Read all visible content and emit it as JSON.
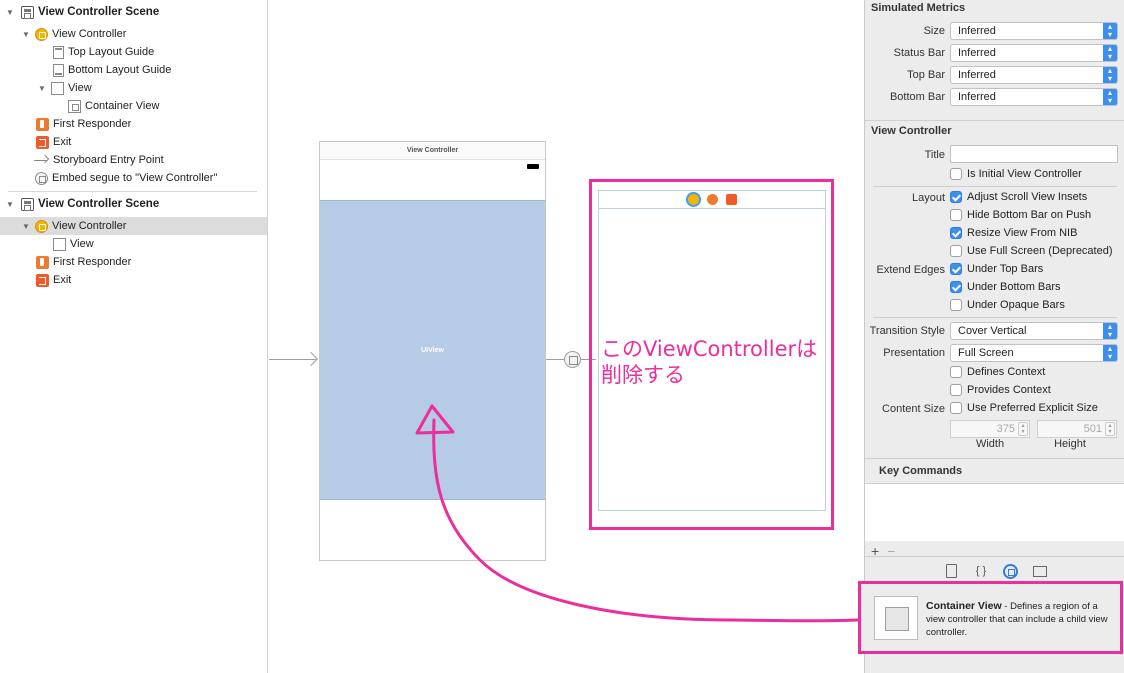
{
  "outline": {
    "scene1": {
      "title": "View Controller Scene",
      "view_controller": "View Controller",
      "top_layout_guide": "Top Layout Guide",
      "bottom_layout_guide": "Bottom Layout Guide",
      "view": "View",
      "container_view": "Container View",
      "first_responder": "First Responder",
      "exit": "Exit",
      "entry_point": "Storyboard Entry Point",
      "embed_segue": "Embed segue to \"View Controller\""
    },
    "scene2": {
      "title": "View Controller Scene",
      "view_controller": "View Controller",
      "view": "View",
      "first_responder": "First Responder",
      "exit": "Exit"
    }
  },
  "canvas": {
    "vc1_title": "View Controller",
    "container_label": "UIView",
    "annotation": "このViewControllerは削除する"
  },
  "inspector": {
    "simulated_metrics": {
      "title": "Simulated Metrics",
      "size_label": "Size",
      "size_value": "Inferred",
      "status_bar_label": "Status Bar",
      "status_bar_value": "Inferred",
      "top_bar_label": "Top Bar",
      "top_bar_value": "Inferred",
      "bottom_bar_label": "Bottom Bar",
      "bottom_bar_value": "Inferred"
    },
    "view_controller": {
      "title": "View Controller",
      "title_label": "Title",
      "title_value": "",
      "is_initial": "Is Initial View Controller",
      "layout_label": "Layout",
      "adjust_scroll": "Adjust Scroll View Insets",
      "hide_bottom_bar": "Hide Bottom Bar on Push",
      "resize_from_nib": "Resize View From NIB",
      "use_full_screen": "Use Full Screen (Deprecated)",
      "extend_edges_label": "Extend Edges",
      "under_top_bars": "Under Top Bars",
      "under_bottom_bars": "Under Bottom Bars",
      "under_opaque_bars": "Under Opaque Bars",
      "transition_label": "Transition Style",
      "transition_value": "Cover Vertical",
      "presentation_label": "Presentation",
      "presentation_value": "Full Screen",
      "defines_context": "Defines Context",
      "provides_context": "Provides Context",
      "content_size_label": "Content Size",
      "use_preferred_size": "Use Preferred Explicit Size",
      "width_value": "375",
      "height_value": "501",
      "width_label": "Width",
      "height_label": "Height"
    },
    "key_commands": {
      "title": "Key Commands"
    },
    "library": {
      "item_title": "Container View",
      "item_desc": " - Defines a region of a view controller that can include a child view controller."
    }
  },
  "colors": {
    "annotation_pink": "#ec2d9c",
    "container_blue": "#b6cbe5",
    "accent_blue": "#3b8ff0",
    "vc_icon_yellow": "#f4b400"
  }
}
